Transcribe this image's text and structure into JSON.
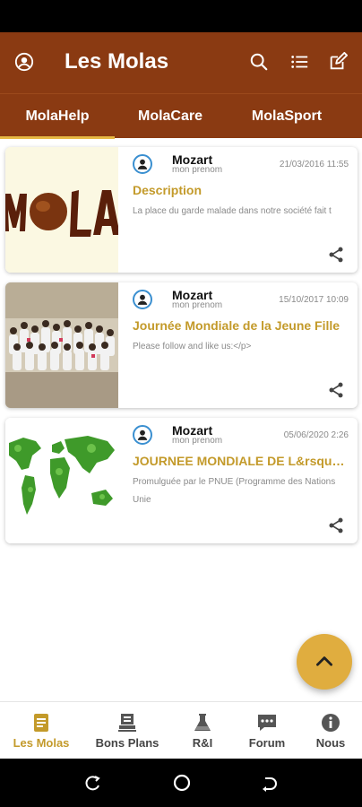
{
  "app": {
    "title": "Les Molas"
  },
  "colors": {
    "primary": "#8a3a12",
    "accent": "#c39a2a",
    "fab": "#e0ad3f"
  },
  "appbar_icons": [
    "account-icon",
    "search-icon",
    "list-icon",
    "edit-icon"
  ],
  "tabs": [
    {
      "label": "MolaHelp",
      "active": true
    },
    {
      "label": "MolaCare",
      "active": false
    },
    {
      "label": "MolaSport",
      "active": false
    }
  ],
  "posts": [
    {
      "author": "Mozart",
      "subname": "mon prenom",
      "date": "21/03/2016 11:55",
      "title": "Description",
      "body": "La place du garde malade dans notre société fait t",
      "thumb_text": "MOLA"
    },
    {
      "author": "Mozart",
      "subname": "mon prenom",
      "date": "15/10/2017 10:09",
      "title": "Journée Mondiale de la Jeune Fille",
      "body": "Please follow and like us:</p>"
    },
    {
      "author": "Mozart",
      "subname": "mon prenom",
      "date": "05/06/2020 2:26",
      "title": "JOURNEE MONDIALE DE L&rsquo;...",
      "body": "Promulguée par le PNUE (Programme des Nations Unie"
    }
  ],
  "bottom_nav": [
    {
      "label": "Les Molas",
      "icon": "document-icon",
      "active": true
    },
    {
      "label": "Bons Plans",
      "icon": "stamp-icon",
      "active": false
    },
    {
      "label": "R&I",
      "icon": "flask-icon",
      "active": false
    },
    {
      "label": "Forum",
      "icon": "chat-icon",
      "active": false
    },
    {
      "label": "Nous",
      "icon": "info-icon",
      "active": false
    }
  ]
}
